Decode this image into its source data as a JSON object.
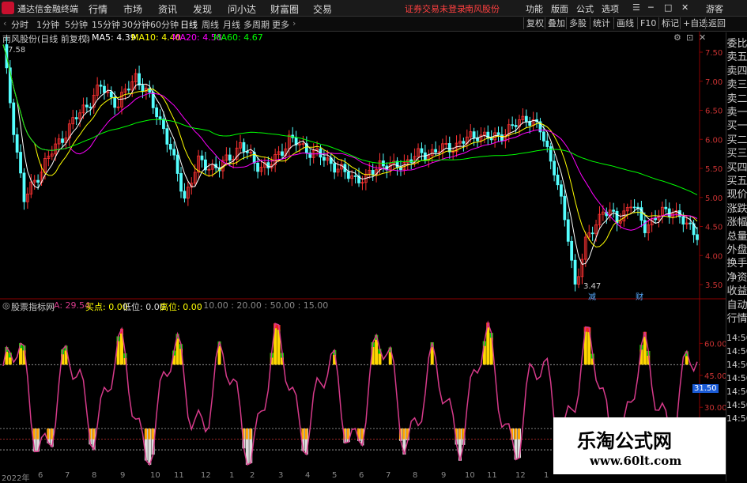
{
  "app": {
    "name": "通达信金融终端",
    "warning": "证券交易未登录",
    "stock_title": "南风股份",
    "guest_label": "游客"
  },
  "menu": [
    "行情",
    "市场",
    "资讯",
    "发现",
    "问小达",
    "财富圈",
    "交易"
  ],
  "toolbar": [
    "功能",
    "版面",
    "公式",
    "选项"
  ],
  "periods": [
    "分时",
    "1分钟",
    "5分钟",
    "15分钟",
    "30分钟",
    "60分钟",
    "日线",
    "周线",
    "月线",
    "多周期",
    "更多"
  ],
  "active_period": "日线",
  "right_buttons": [
    "复权",
    "叠加",
    "多股",
    "统计",
    "画线",
    "F10",
    "标记",
    "+自选",
    "返回"
  ],
  "main_legend": {
    "title": "南风股份(日线 前复权)",
    "ma5": "MA5: 4.39",
    "ma10": "MA10: 4.40",
    "ma20": "MA20: 4.58",
    "ma60": "MA60: 4.67"
  },
  "price_axis": [
    "7.50",
    "7.00",
    "6.50",
    "6.00",
    "5.50",
    "5.00",
    "4.50",
    "4.00",
    "3.50"
  ],
  "annotations": {
    "high": "7.58",
    "low": "3.47",
    "mark1": "减",
    "mark2": "财"
  },
  "indicator_legend": {
    "name": "股票指标网",
    "a": "A: 29.54",
    "buy": "买点: 0.00",
    "low": "低位: 0.00",
    "high": "高位: 0.00",
    "levels": ": 10.00 : 20.00 : 50.00 : 15.00"
  },
  "indicator_axis": [
    "60.00",
    "45.00",
    "30.00"
  ],
  "indicator_current": "31.50",
  "side_panel": [
    "委比",
    "卖五",
    "卖四",
    "卖三",
    "卖二",
    "卖一",
    "买一",
    "买二",
    "买三",
    "买四",
    "买五",
    "现价",
    "涨跌",
    "涨幅",
    "总量",
    "外盘",
    "换手",
    "净资",
    "收益",
    "自动",
    "行情"
  ],
  "side_times": [
    "14:50",
    "14:50",
    "14:50",
    "14:50",
    "14:50",
    "14:50",
    "14:50"
  ],
  "x_labels": [
    "2022年",
    "6",
    "7",
    "8",
    "9",
    "10",
    "11",
    "12",
    "1",
    "2",
    "3",
    "4",
    "5",
    "6",
    "7",
    "8",
    "9",
    "10",
    "11",
    "12",
    "1"
  ],
  "watermark": {
    "cn": "乐淘公式网",
    "url": "www.60lt.com"
  },
  "colors": {
    "ma5": "#ffffff",
    "ma10": "#ffff00",
    "ma20": "#ff00ff",
    "ma60": "#00ff00",
    "up": "#ff3232",
    "down": "#54ffff",
    "indicator": "#d63a8a"
  }
}
